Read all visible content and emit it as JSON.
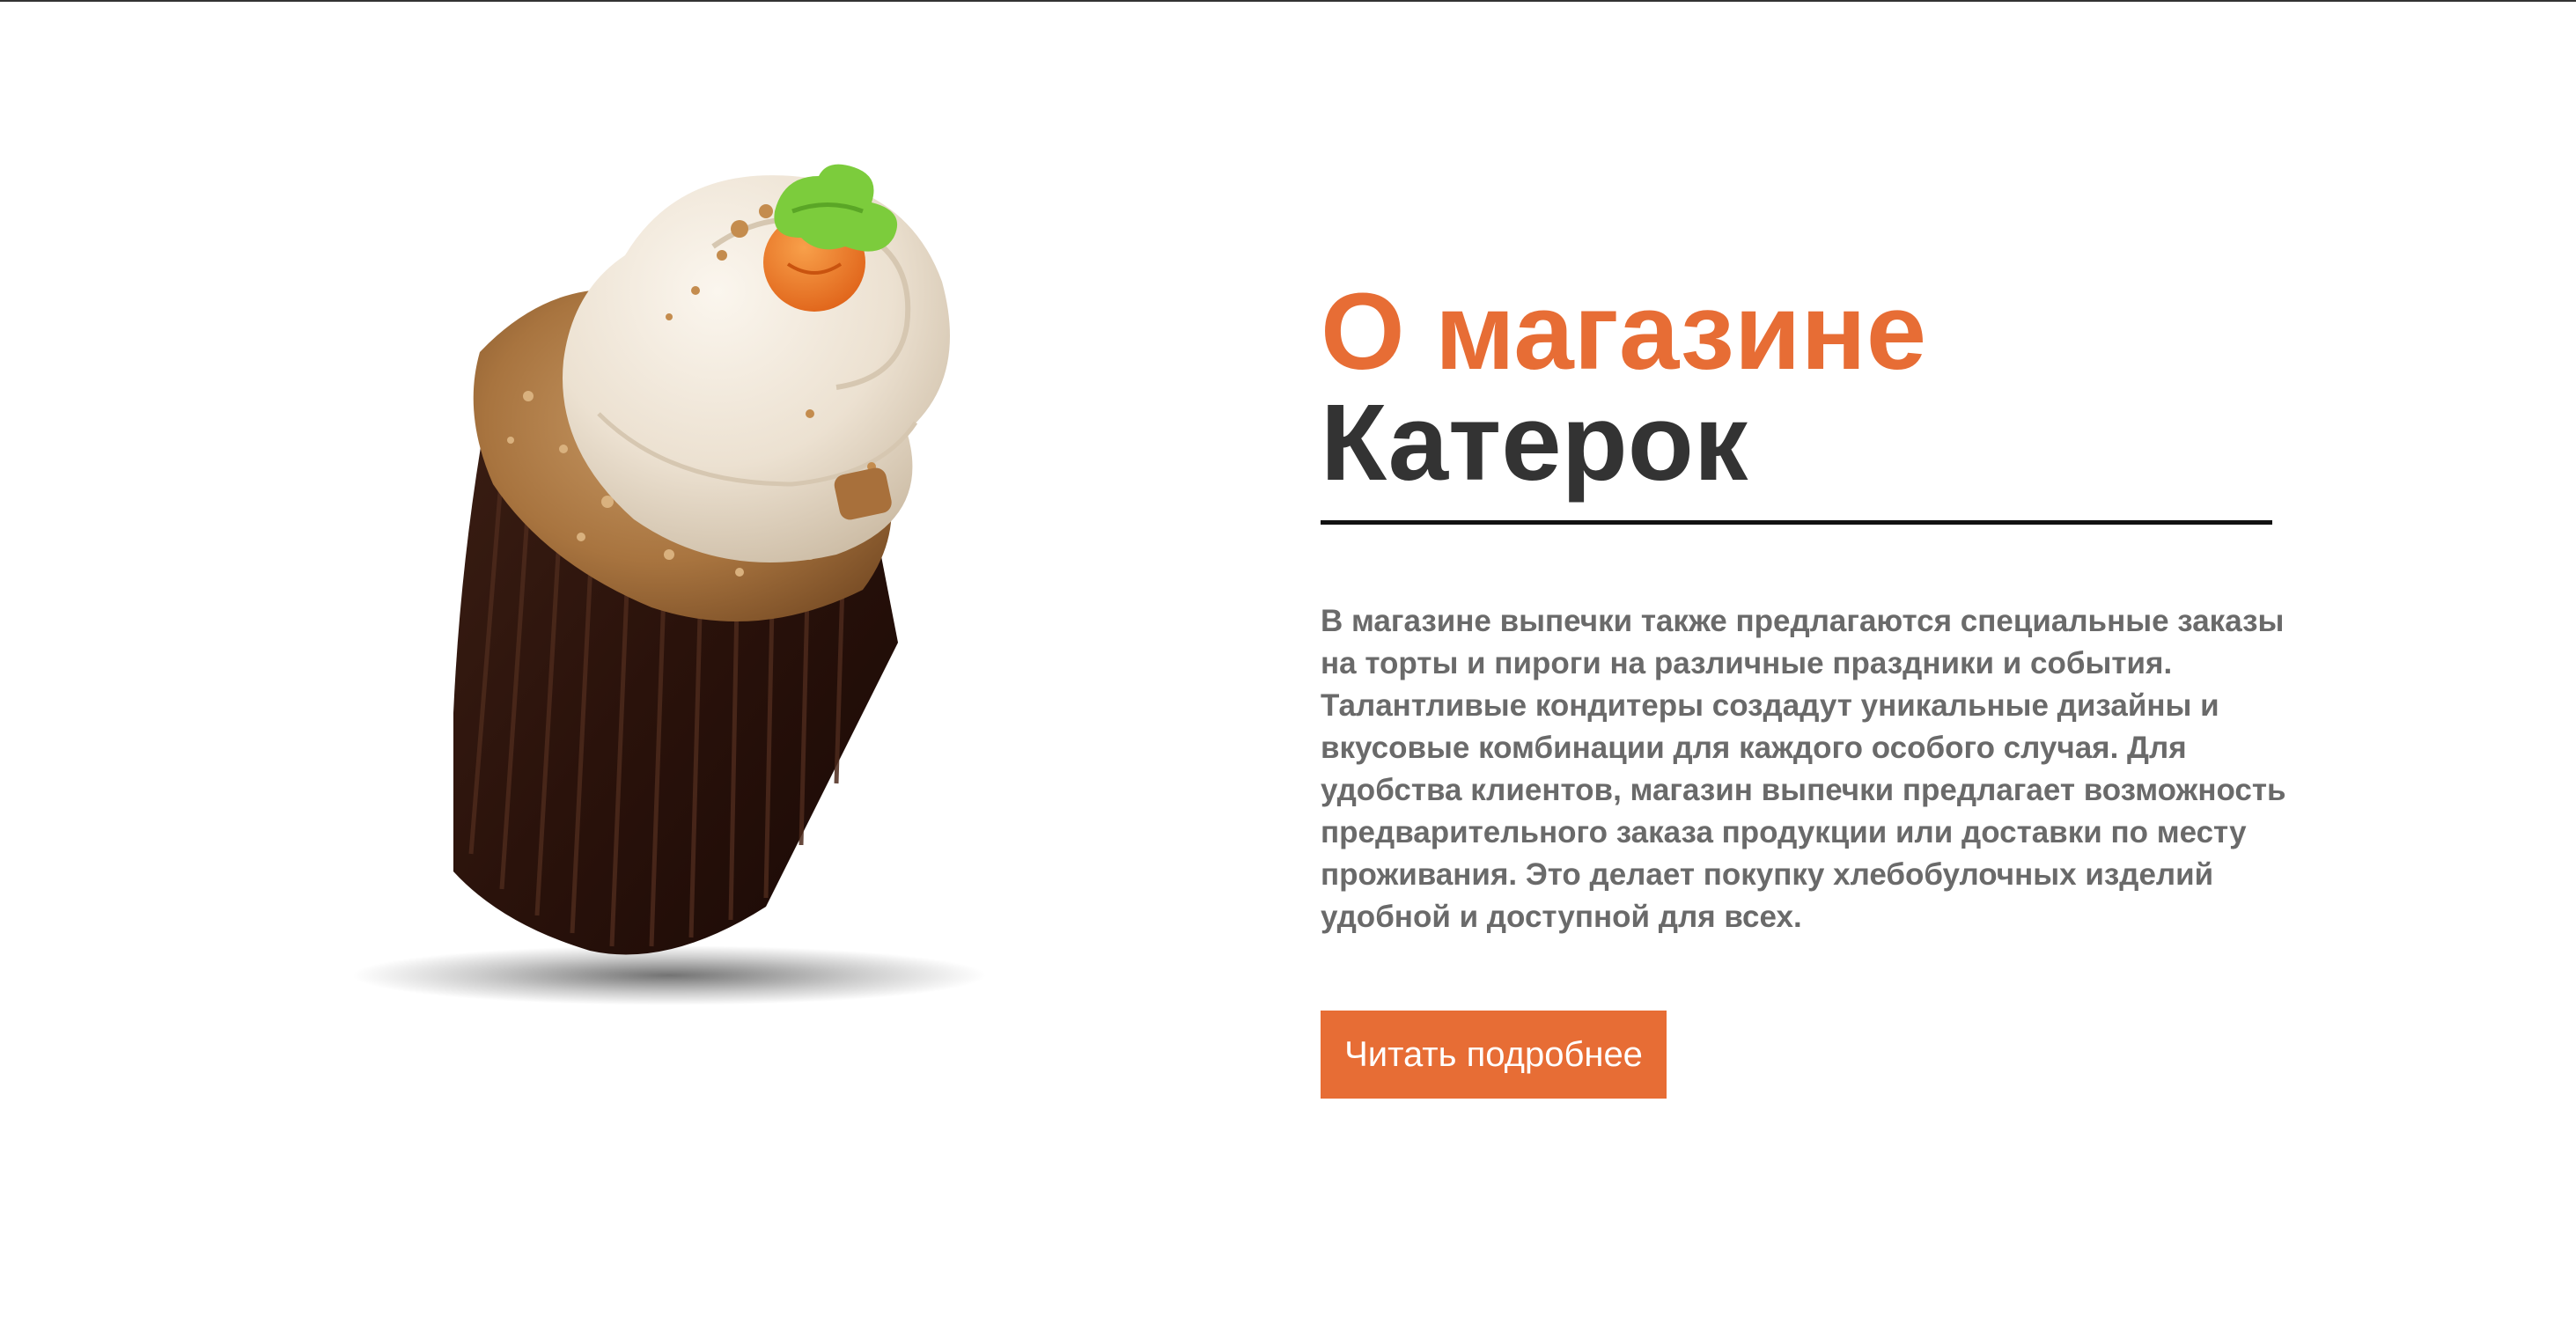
{
  "about": {
    "title_accent": "О магазине",
    "title_main": "Катерок",
    "description": "В магазине выпечки также предлагаются специальные заказы на торты и пироги на различные праздники и события. Талантливые кондитеры создадут уникальные дизайны и вкусовые комбинации для каждого особого случая. Для удобства клиентов, магазин выпечки предлагает возможность предварительного заказа продукции или доставки по месту проживания. Это делает покупку хлебобулочных изделий удобной и доступной для всех.",
    "button_label": "Читать подробнее"
  },
  "colors": {
    "accent": "#e76d35",
    "heading": "#333333",
    "text": "#6a6a6a",
    "background": "#ffffff"
  },
  "image": {
    "subject": "carrot-cupcake"
  }
}
